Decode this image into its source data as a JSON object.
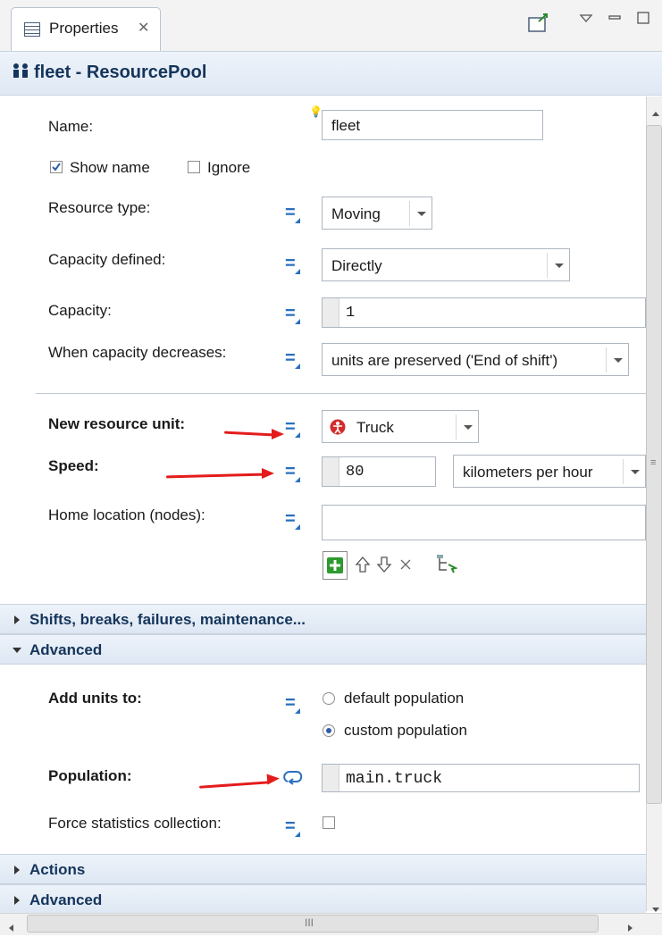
{
  "tab": {
    "title": "Properties",
    "close_glyph": "✕"
  },
  "header": {
    "title": "fleet - ResourcePool",
    "icon": "resource-pool-icon"
  },
  "form": {
    "name_label": "Name:",
    "name_value": "fleet",
    "show_name_label": "Show name",
    "show_name_checked": true,
    "ignore_label": "Ignore",
    "ignore_checked": false,
    "resource_type_label": "Resource type:",
    "resource_type_value": "Moving",
    "capacity_defined_label": "Capacity defined:",
    "capacity_defined_value": "Directly",
    "capacity_label": "Capacity:",
    "capacity_value": "1",
    "capacity_decreases_label": "When capacity decreases:",
    "capacity_decreases_value": "units are preserved ('End of shift')",
    "new_resource_unit_label": "New resource unit:",
    "new_resource_unit_value": "Truck",
    "speed_label": "Speed:",
    "speed_value": "80",
    "speed_unit_value": "kilometers per hour",
    "home_location_label": "Home location (nodes):",
    "home_location_value": ""
  },
  "sections": {
    "shifts": "Shifts, breaks, failures, maintenance...",
    "advanced": "Advanced",
    "actions": "Actions",
    "advanced2": "Advanced"
  },
  "advanced": {
    "add_units_label": "Add units to:",
    "option_default": "default population",
    "option_custom": "custom population",
    "selected_option": "custom population",
    "population_label": "Population:",
    "population_value": "main.truck",
    "force_stats_label": "Force statistics collection:",
    "force_stats_checked": false
  },
  "scrollbar": {
    "hgrip": "III"
  },
  "colors": {
    "header_text": "#15355b",
    "annotation_arrow": "#e41b1b",
    "equals_icon": "#2a6fc0"
  }
}
